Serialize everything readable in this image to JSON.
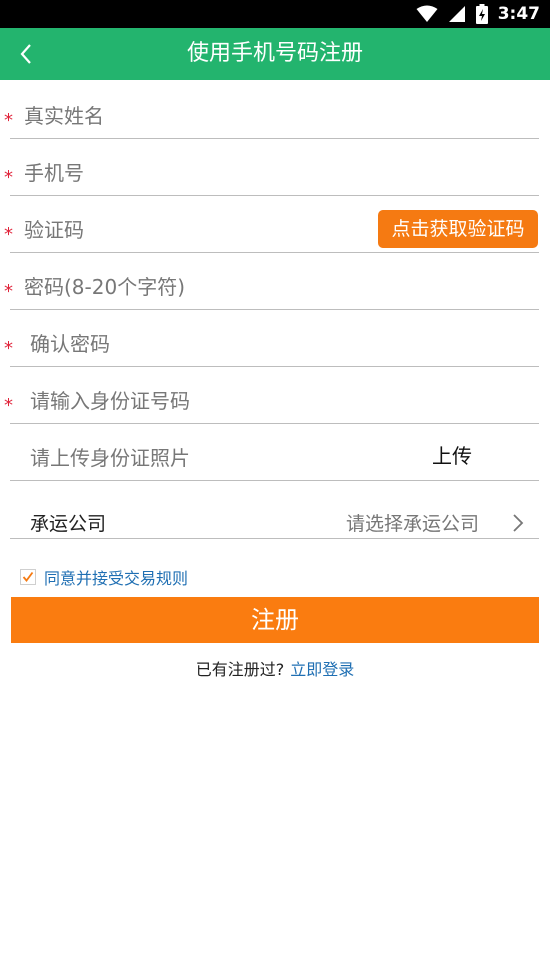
{
  "status_bar": {
    "time": "3:47",
    "icons": [
      "wifi-icon",
      "signal-icon",
      "battery-charging-icon"
    ]
  },
  "header": {
    "title": "使用手机号码注册",
    "back_icon": "chevron-left-icon"
  },
  "form": {
    "name_placeholder": "真实姓名",
    "phone_placeholder": "手机号",
    "code_placeholder": "验证码",
    "get_code_label": "点击获取验证码",
    "password_placeholder": "密码(8-20个字符)",
    "confirm_password_placeholder": "确认密码",
    "id_number_placeholder": "请输入身份证号码",
    "id_photo_placeholder": "请上传身份证照片",
    "upload_label": "上传",
    "company_label": "承运公司",
    "company_select_placeholder": "请选择承运公司",
    "required_mark": "*"
  },
  "agreement": {
    "checked": true,
    "text": "同意并接受交易规则"
  },
  "register_label": "注册",
  "login": {
    "question": "已有注册过?",
    "link": "立即登录"
  },
  "colors": {
    "header_bg": "#23b46e",
    "accent_orange": "#f57a12",
    "register_bg": "#fa7c10",
    "link_blue": "#1f6fb3",
    "required_red": "#e0233a"
  }
}
